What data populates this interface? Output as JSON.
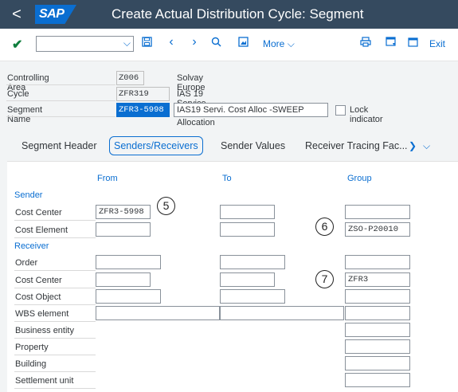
{
  "shell": {
    "back_label": "<",
    "logo": "SAP",
    "title": "Create Actual Distribution Cycle: Segment"
  },
  "toolbar": {
    "combo_value": "",
    "more_label": "More",
    "exit_label": "Exit"
  },
  "header": {
    "rows": [
      {
        "label": "Controlling Area",
        "value": "Z006",
        "desc": "Solvay Europe"
      },
      {
        "label": "Cycle",
        "value": "ZFR319",
        "desc": "IAS 19 Service Cost Allocation"
      },
      {
        "label": "Segment Name",
        "value": "ZFR3-5998",
        "desc": "IAS19 Servi. Cost Alloc -SWEEP"
      }
    ],
    "lock_label": "Lock indicator",
    "lock_checked": false
  },
  "tabs": [
    "Segment Header",
    "Senders/Receivers",
    "Sender Values",
    "Receiver Tracing Fac..."
  ],
  "active_tab": "Senders/Receivers",
  "grid": {
    "columns": {
      "from": "From",
      "to": "To",
      "group": "Group"
    },
    "sender_title": "Sender",
    "receiver_title": "Receiver",
    "rows": {
      "cost_center_s": {
        "label": "Cost Center",
        "from": "ZFR3-5998",
        "to": "",
        "group": ""
      },
      "cost_element": {
        "label": "Cost Element",
        "from": "",
        "to": "",
        "group": "ZSO-P20010"
      },
      "order": {
        "label": "Order",
        "from": "",
        "to": "",
        "group": ""
      },
      "cost_center_r": {
        "label": "Cost Center",
        "from": "",
        "to": "",
        "group": "ZFR3"
      },
      "cost_object": {
        "label": "Cost Object",
        "from": "",
        "to": "",
        "group": ""
      },
      "wbs": {
        "label": "WBS element",
        "from": "",
        "to": "",
        "group": ""
      },
      "business_entity": {
        "label": "Business entity",
        "group": ""
      },
      "property": {
        "label": "Property",
        "group": ""
      },
      "building": {
        "label": "Building",
        "group": ""
      },
      "settlement_unit": {
        "label": "Settlement unit",
        "group": ""
      }
    }
  },
  "callouts": [
    "5",
    "6",
    "7"
  ]
}
